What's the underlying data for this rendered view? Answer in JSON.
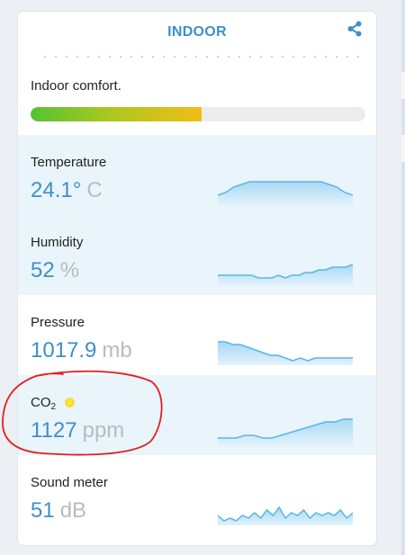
{
  "panel": {
    "title": "INDOOR",
    "comfort": {
      "label": "Indoor comfort.",
      "level": 0.51
    }
  },
  "metrics": [
    {
      "id": "temperature",
      "label": "Temperature",
      "value": "24.1°",
      "unit": "C",
      "trend": [
        3,
        4,
        6,
        7,
        8,
        8,
        8,
        8,
        8,
        8,
        8,
        8,
        8,
        8,
        7,
        6,
        4,
        3
      ]
    },
    {
      "id": "humidity",
      "label": "Humidity",
      "value": "52",
      "unit": "%",
      "trend": [
        3,
        3,
        3,
        3,
        3,
        3,
        2,
        2,
        2,
        3,
        2,
        3,
        3,
        4,
        4,
        5,
        5,
        6,
        6,
        6,
        7
      ]
    },
    {
      "id": "pressure",
      "label": "Pressure",
      "value": "1017.9",
      "unit": "mb",
      "trend": [
        8,
        8,
        7,
        7,
        6,
        5,
        4,
        3,
        3,
        2,
        1,
        2,
        1,
        2,
        2,
        2,
        2,
        2,
        2
      ]
    },
    {
      "id": "co2",
      "label": "CO",
      "label_sub": "2",
      "value": "1127",
      "unit": "ppm",
      "trend": [
        2,
        2,
        2,
        3,
        3,
        2,
        2,
        3,
        4,
        5,
        6,
        7,
        8,
        8,
        9,
        9
      ]
    },
    {
      "id": "sound",
      "label": "Sound meter",
      "value": "51",
      "unit": "dB",
      "trend": [
        3,
        1,
        2,
        1,
        3,
        2,
        4,
        2,
        5,
        3,
        6,
        2,
        4,
        3,
        5,
        2,
        4,
        3,
        4,
        3,
        5,
        2,
        4
      ]
    }
  ],
  "colors": {
    "accent": "#3f8fc7",
    "unit": "#b7bcc2",
    "spark_line": "#5bb6e6",
    "spark_fill_top": "#a8d9f3",
    "spark_fill_bottom": "#e2f2fb",
    "comfort_gradient": [
      "#55c233",
      "#a8c820",
      "#f2be14"
    ],
    "co2_indicator": "#fbd30d",
    "annotation": "#e0201c"
  },
  "icons": {
    "share": "share-icon",
    "co2_status": "co2-status-dot"
  }
}
